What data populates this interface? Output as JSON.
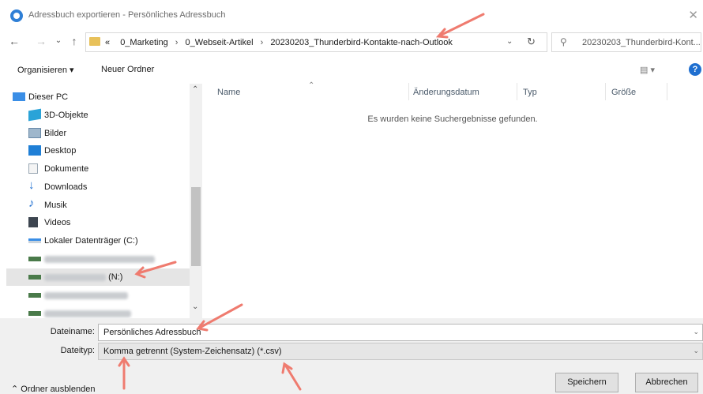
{
  "window": {
    "title": "Adressbuch exportieren - Persönliches Adressbuch",
    "close_glyph": "✕"
  },
  "addressbar": {
    "back_glyph": "←",
    "forward_glyph": "→",
    "recent_glyph": "⌄",
    "up_glyph": "↑",
    "overflow": "«",
    "crumbs": [
      "0_Marketing",
      "0_Webseit-Artikel",
      "20230203_Thunderbird-Kontakte-nach-Outlook"
    ],
    "separator": "›",
    "dropdown_glyph": "⌄",
    "refresh_glyph": "↻",
    "search_placeholder": "20230203_Thunderbird-Kont...",
    "search_glyph": "⚲"
  },
  "toolbar": {
    "organize": "Organisieren ▾",
    "new_folder": "Neuer Ordner",
    "view_glyph": "▤ ▾",
    "help_glyph": "?"
  },
  "nav": {
    "items": [
      {
        "label": "Dieser PC",
        "icon": "pc-icon"
      },
      {
        "label": "3D-Objekte",
        "icon": "cube-icon"
      },
      {
        "label": "Bilder",
        "icon": "pictures-icon"
      },
      {
        "label": "Desktop",
        "icon": "desktop-icon"
      },
      {
        "label": "Dokumente",
        "icon": "documents-icon"
      },
      {
        "label": "Downloads",
        "icon": "download-icon"
      },
      {
        "label": "Musik",
        "icon": "music-icon"
      },
      {
        "label": "Videos",
        "icon": "video-icon"
      },
      {
        "label": "Lokaler Datenträger (C:)",
        "icon": "drive-icon"
      }
    ],
    "selected_drive_suffix": "(N:)",
    "scroll_up": "⌃",
    "scroll_down": "⌄"
  },
  "filelist": {
    "columns": [
      "Name",
      "Änderungsdatum",
      "Typ",
      "Größe"
    ],
    "sort_glyph": "⌃",
    "empty_message": "Es wurden keine Suchergebnisse gefunden."
  },
  "form": {
    "filename_label": "Dateiname:",
    "filename_value": "Persönliches Adressbuch",
    "filetype_label": "Dateityp:",
    "filetype_value": "Komma getrennt (System-Zeichensatz) (*.csv)",
    "dropdown_glyph": "⌄"
  },
  "footer": {
    "hide_folders": "⌃  Ordner ausblenden",
    "save": "Speichern",
    "cancel": "Abbrechen"
  },
  "colors": {
    "annotation_arrow": "#ef7b6f",
    "accent_blue": "#1f6fd0",
    "folder_yellow": "#e8c15a"
  }
}
